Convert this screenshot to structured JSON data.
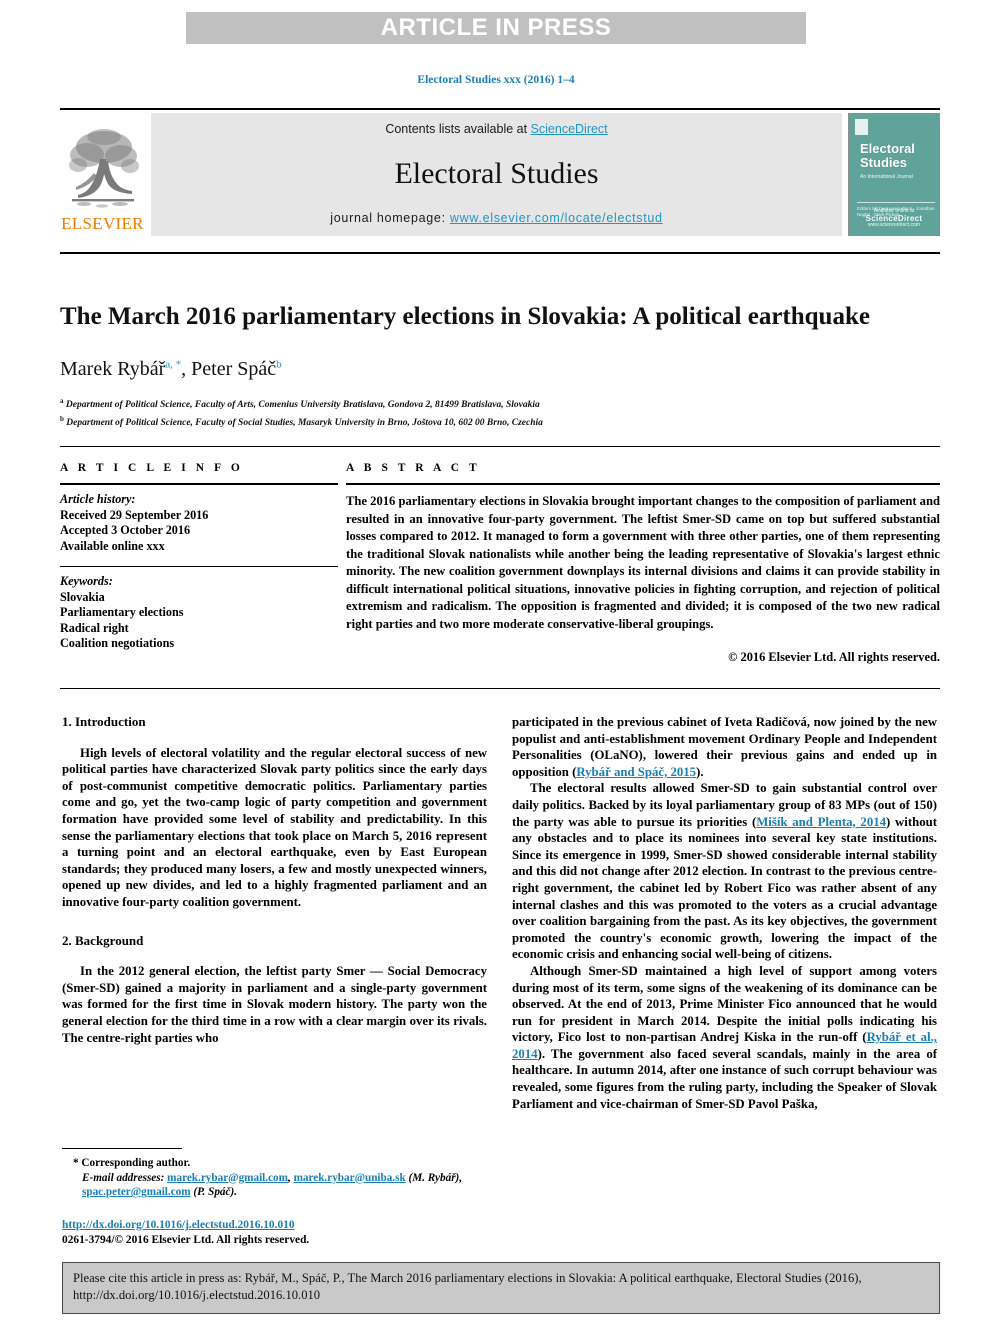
{
  "banner": {
    "text": "ARTICLE IN PRESS"
  },
  "running_head": "Electoral Studies xxx (2016) 1–4",
  "masthead": {
    "elsevier_wordmark": "ELSEVIER",
    "contents_prefix": "Contents lists available at ",
    "contents_link": "ScienceDirect",
    "journal_name": "Electoral Studies",
    "homepage_prefix": "journal homepage: ",
    "homepage_url": "www.elsevier.com/locate/electstud",
    "cover": {
      "title_line1": "Electoral",
      "title_line2": "Studies",
      "subtitle": "An International Journal",
      "editors": "Editors\nMichael Lewis-Beck · Jonathan Nagler · Mark Pickup",
      "publisher_label": "Available online at",
      "publisher": "ScienceDirect",
      "publisher_sub": "www.sciencedirect.com",
      "color": "#5fa39b"
    }
  },
  "article": {
    "title": "The March 2016 parliamentary elections in Slovakia: A political earthquake",
    "authors": [
      {
        "name": "Marek Rybář",
        "marks": "a, *"
      },
      {
        "name": "Peter Spáč",
        "marks": "b"
      }
    ],
    "affiliations": [
      {
        "mark": "a",
        "text": "Department of Political Science, Faculty of Arts, Comenius University Bratislava, Gondova 2, 81499 Bratislava, Slovakia"
      },
      {
        "mark": "b",
        "text": "Department of Political Science, Faculty of Social Studies, Masaryk University in Brno, Joštova 10, 602 00 Brno, Czechia"
      }
    ]
  },
  "article_info": {
    "heading": "A R T I C L E   I N F O",
    "history_label": "Article history:",
    "history": [
      "Received 29 September 2016",
      "Accepted 3 October 2016",
      "Available online xxx"
    ],
    "keywords_label": "Keywords:",
    "keywords": [
      "Slovakia",
      "Parliamentary elections",
      "Radical right",
      "Coalition negotiations"
    ]
  },
  "abstract": {
    "heading": "A B S T R A C T",
    "text": "The 2016 parliamentary elections in Slovakia brought important changes to the composition of parliament and resulted in an innovative four-party government. The leftist Smer-SD came on top but suffered substantial losses compared to 2012. It managed to form a government with three other parties, one of them representing the traditional Slovak nationalists while another being the leading representative of Slovakia's largest ethnic minority. The new coalition government downplays its internal divisions and claims it can provide stability in difficult international political situations, innovative policies in fighting corruption, and rejection of political extremism and radicalism. The opposition is fragmented and divided; it is composed of the two new radical right parties and two more moderate conservative-liberal groupings.",
    "copyright": "© 2016 Elsevier Ltd. All rights reserved."
  },
  "body": {
    "left": {
      "section1_heading": "1. Introduction",
      "section1_para1": "High levels of electoral volatility and the regular electoral success of new political parties have characterized Slovak party politics since the early days of post-communist competitive democratic politics. Parliamentary parties come and go, yet the two-camp logic of party competition and government formation have provided some level of stability and predictability. In this sense the parliamentary elections that took place on March 5, 2016 represent a turning point and an electoral earthquake, even by East European standards; they produced many losers, a few and mostly unexpected winners, opened up new divides, and led to a highly fragmented parliament and an innovative four-party coalition government.",
      "section2_heading": "2. Background",
      "section2_para1": "In the 2012 general election, the leftist party Smer — Social Democracy (Smer-SD) gained a majority in parliament and a single-party government was formed for the first time in Slovak modern history. The party won the general election for the third time in a row with a clear margin over its rivals. The centre-right parties who"
    },
    "right": {
      "para1_part1": "participated in the previous cabinet of Iveta Radičová, now joined by the new populist and anti-establishment movement Ordinary People and Independent Personalities (OLaNO), lowered their previous gains and ended up in opposition (",
      "para1_ref": "Rybář and Spáč, 2015",
      "para1_part2": ").",
      "para2_part1": "The electoral results allowed Smer-SD to gain substantial control over daily politics. Backed by its loyal parliamentary group of 83 MPs (out of 150) the party was able to pursue its priorities (",
      "para2_ref": "Mišík and Plenta, 2014",
      "para2_part2": ") without any obstacles and to place its nominees into several key state institutions. Since its emergence in 1999, Smer-SD showed considerable internal stability and this did not change after 2012 election. In contrast to the previous centre-right government, the cabinet led by Robert Fico was rather absent of any internal clashes and this was promoted to the voters as a crucial advantage over coalition bargaining from the past. As its key objectives, the government promoted the country's economic growth, lowering the impact of the economic crisis and enhancing social well-being of citizens.",
      "para3_part1": "Although Smer-SD maintained a high level of support among voters during most of its term, some signs of the weakening of its dominance can be observed. At the end of 2013, Prime Minister Fico announced that he would run for president in March 2014. Despite the initial polls indicating his victory, Fico lost to non-partisan Andrej Kiska in the run-off (",
      "para3_ref": "Rybář et al., 2014",
      "para3_part2": "). The government also faced several scandals, mainly in the area of healthcare. In autumn 2014, after one instance of such corrupt behaviour was revealed, some figures from the ruling party, including the Speaker of Slovak Parliament and vice-chairman of Smer-SD Pavol Paška,"
    }
  },
  "footnotes": {
    "corresponding": "* Corresponding author.",
    "email_label": "E-mail addresses:",
    "email1": "marek.rybar@gmail.com",
    "email_sep1": ", ",
    "email2": "marek.rybar@uniba.sk",
    "email_author1": " (M. Rybář),",
    "email3": "spac.peter@gmail.com",
    "email_author2": " (P. Spáč)."
  },
  "doi": {
    "url": "http://dx.doi.org/10.1016/j.electstud.2016.10.010",
    "issn_line": "0261-3794/© 2016 Elsevier Ltd. All rights reserved."
  },
  "citation_box": {
    "text": "Please cite this article in press as: Rybář, M., Spáč, P., The March 2016 parliamentary elections in Slovakia: A political earthquake, Electoral Studies (2016), http://dx.doi.org/10.1016/j.electstud.2016.10.010"
  },
  "colors": {
    "banner_bg": "#c0c0c0",
    "link": "#1a7fb5",
    "sciencedirect": "#2196c4",
    "elsevier_orange": "#f07c00",
    "masthead_bg": "#e6e6e6",
    "cite_box_bg": "#c9c9c9"
  }
}
